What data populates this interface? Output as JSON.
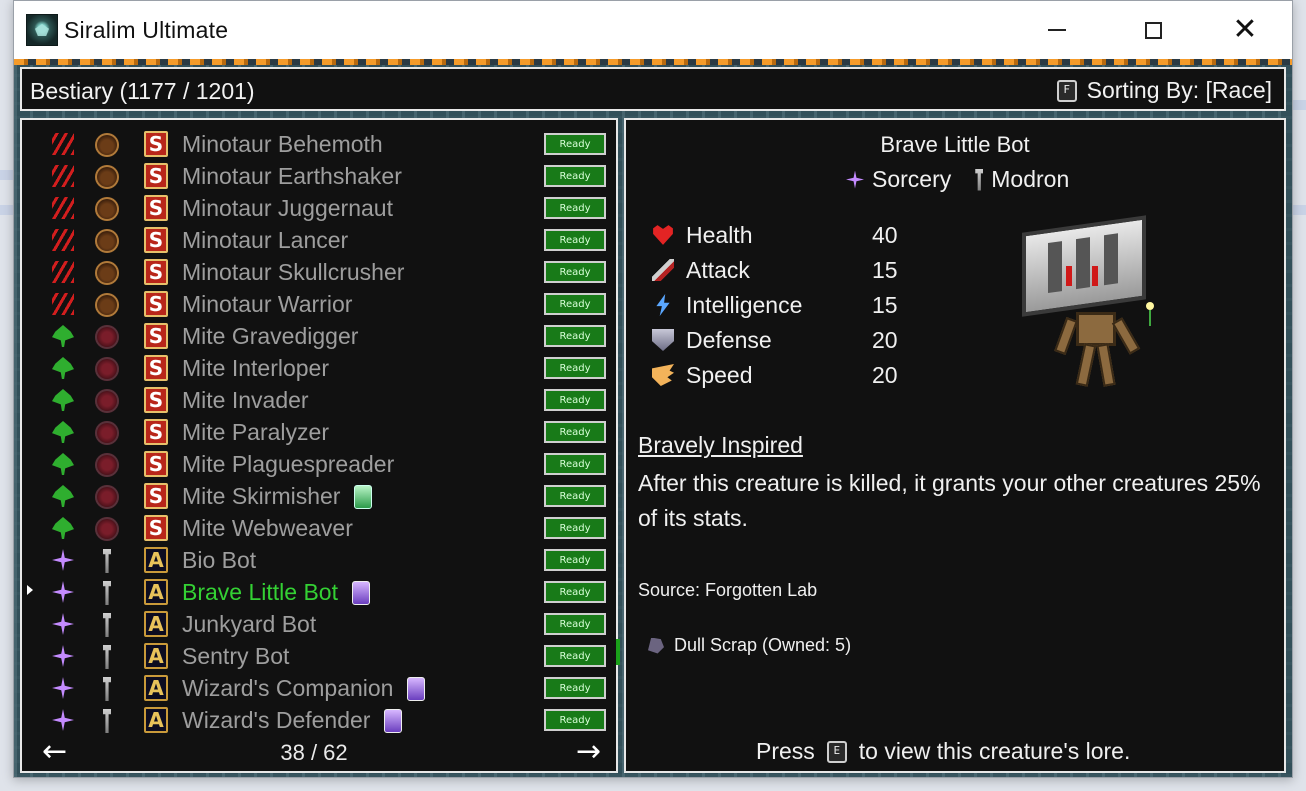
{
  "window": {
    "title": "Siralim Ultimate"
  },
  "header": {
    "title": "Bestiary (1177 / 1201)",
    "sort_key": "F",
    "sort_label": "Sorting By: [Race]"
  },
  "list": {
    "items": [
      {
        "name": "Minotaur Behemoth",
        "class_icon": "claw-icon",
        "race_icon": "minotaur-race-icon",
        "letter": "S",
        "trait_gem": "",
        "status": "Ready"
      },
      {
        "name": "Minotaur Earthshaker",
        "class_icon": "claw-icon",
        "race_icon": "minotaur-race-icon",
        "letter": "S",
        "trait_gem": "",
        "status": "Ready"
      },
      {
        "name": "Minotaur Juggernaut",
        "class_icon": "claw-icon",
        "race_icon": "minotaur-race-icon",
        "letter": "S",
        "trait_gem": "",
        "status": "Ready"
      },
      {
        "name": "Minotaur Lancer",
        "class_icon": "claw-icon",
        "race_icon": "minotaur-race-icon",
        "letter": "S",
        "trait_gem": "",
        "status": "Ready"
      },
      {
        "name": "Minotaur Skullcrusher",
        "class_icon": "claw-icon",
        "race_icon": "minotaur-race-icon",
        "letter": "S",
        "trait_gem": "",
        "status": "Ready"
      },
      {
        "name": "Minotaur Warrior",
        "class_icon": "claw-icon",
        "race_icon": "minotaur-race-icon",
        "letter": "S",
        "trait_gem": "",
        "status": "Ready"
      },
      {
        "name": "Mite Gravedigger",
        "class_icon": "leaf-icon",
        "race_icon": "mite-race-icon",
        "letter": "S",
        "trait_gem": "",
        "status": "Ready"
      },
      {
        "name": "Mite Interloper",
        "class_icon": "leaf-icon",
        "race_icon": "mite-race-icon",
        "letter": "S",
        "trait_gem": "",
        "status": "Ready"
      },
      {
        "name": "Mite Invader",
        "class_icon": "leaf-icon",
        "race_icon": "mite-race-icon",
        "letter": "S",
        "trait_gem": "",
        "status": "Ready"
      },
      {
        "name": "Mite Paralyzer",
        "class_icon": "leaf-icon",
        "race_icon": "mite-race-icon",
        "letter": "S",
        "trait_gem": "",
        "status": "Ready"
      },
      {
        "name": "Mite Plaguespreader",
        "class_icon": "leaf-icon",
        "race_icon": "mite-race-icon",
        "letter": "S",
        "trait_gem": "",
        "status": "Ready"
      },
      {
        "name": "Mite Skirmisher",
        "class_icon": "leaf-icon",
        "race_icon": "mite-race-icon",
        "letter": "S",
        "trait_gem": "green",
        "status": "Ready"
      },
      {
        "name": "Mite Webweaver",
        "class_icon": "leaf-icon",
        "race_icon": "mite-race-icon",
        "letter": "S",
        "trait_gem": "",
        "status": "Ready"
      },
      {
        "name": "Bio Bot",
        "class_icon": "sorcery-icon",
        "race_icon": "modron-race-icon",
        "letter": "A",
        "trait_gem": "",
        "status": "Ready"
      },
      {
        "name": "Brave Little Bot",
        "class_icon": "sorcery-icon",
        "race_icon": "modron-race-icon",
        "letter": "A",
        "trait_gem": "purple",
        "status": "Ready",
        "selected": true
      },
      {
        "name": "Junkyard Bot",
        "class_icon": "sorcery-icon",
        "race_icon": "modron-race-icon",
        "letter": "A",
        "trait_gem": "",
        "status": "Ready"
      },
      {
        "name": "Sentry Bot",
        "class_icon": "sorcery-icon",
        "race_icon": "modron-race-icon",
        "letter": "A",
        "trait_gem": "",
        "status": "Ready"
      },
      {
        "name": "Wizard's Companion",
        "class_icon": "sorcery-icon",
        "race_icon": "modron-race-icon",
        "letter": "A",
        "trait_gem": "purple",
        "status": "Ready"
      },
      {
        "name": "Wizard's Defender",
        "class_icon": "sorcery-icon",
        "race_icon": "modron-race-icon",
        "letter": "A",
        "trait_gem": "purple",
        "status": "Ready"
      }
    ],
    "page": "38 / 62",
    "prev_arrow": "←",
    "next_arrow": "→"
  },
  "detail": {
    "name": "Brave Little Bot",
    "class": "Sorcery",
    "race": "Modron",
    "stats": [
      {
        "label": "Health",
        "value": "40",
        "icon": "heart-icon"
      },
      {
        "label": "Attack",
        "value": "15",
        "icon": "sword-icon"
      },
      {
        "label": "Intelligence",
        "value": "15",
        "icon": "lightning-icon"
      },
      {
        "label": "Defense",
        "value": "20",
        "icon": "shield-icon"
      },
      {
        "label": "Speed",
        "value": "20",
        "icon": "wing-icon"
      }
    ],
    "trait_name": "Bravely Inspired",
    "trait_description": "After this creature is killed, it grants your other creatures 25% of its stats.",
    "source": "Source: Forgotten Lab",
    "material": "Dull Scrap (Owned: 5)",
    "lore_prefix": "Press",
    "lore_key": "E",
    "lore_suffix": "to view this creature's lore."
  },
  "colors": {
    "selected_name": "#34d134",
    "ready_bg": "#187a18",
    "panel_bg": "#111111"
  }
}
